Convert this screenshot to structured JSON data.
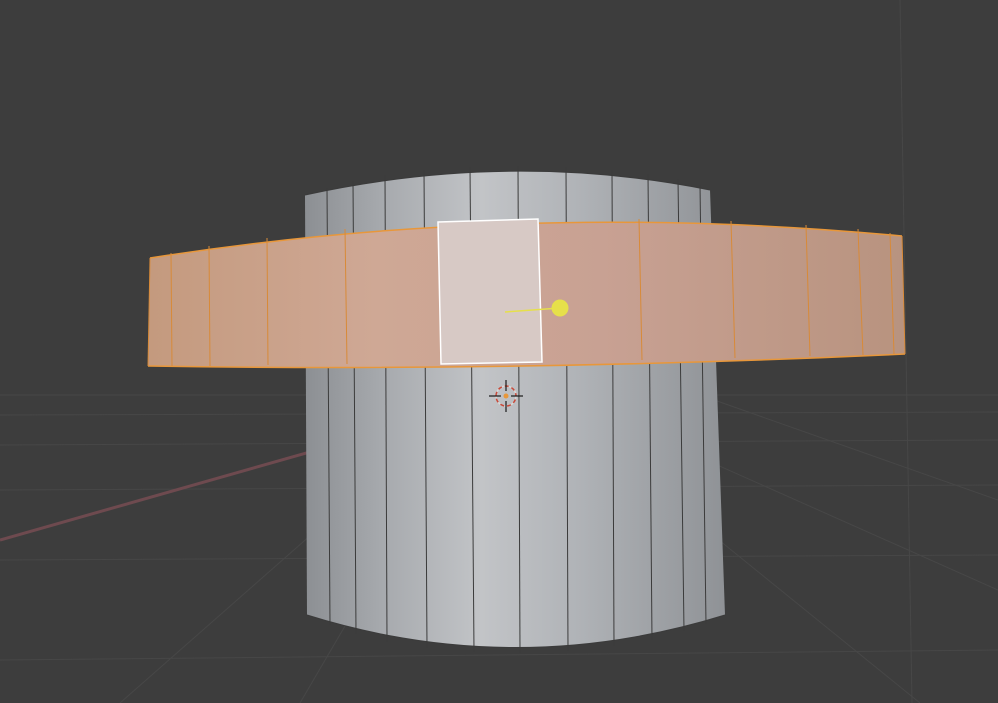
{
  "viewport": {
    "background_color": "#3d3d3d",
    "grid_color": "#474747",
    "x_axis_color": "#6e4a4f",
    "mode": "edit-mode-face-select"
  },
  "objects": [
    {
      "name": "cylinder",
      "type": "mesh",
      "segments_visible": 14,
      "surface_color": "#a9acb0",
      "edge_color": "#3b3b3b"
    },
    {
      "name": "ring",
      "type": "mesh",
      "selected": true,
      "surface_color": "#caa593",
      "edge_color": "#e8973a",
      "active_face_color": "#d7c9c5",
      "active_face_outline": "#ffffff"
    }
  ],
  "icons": {
    "light": "sun-lamp-icon",
    "cursor": "3d-cursor-icon"
  },
  "light_color": "#e6e04a"
}
